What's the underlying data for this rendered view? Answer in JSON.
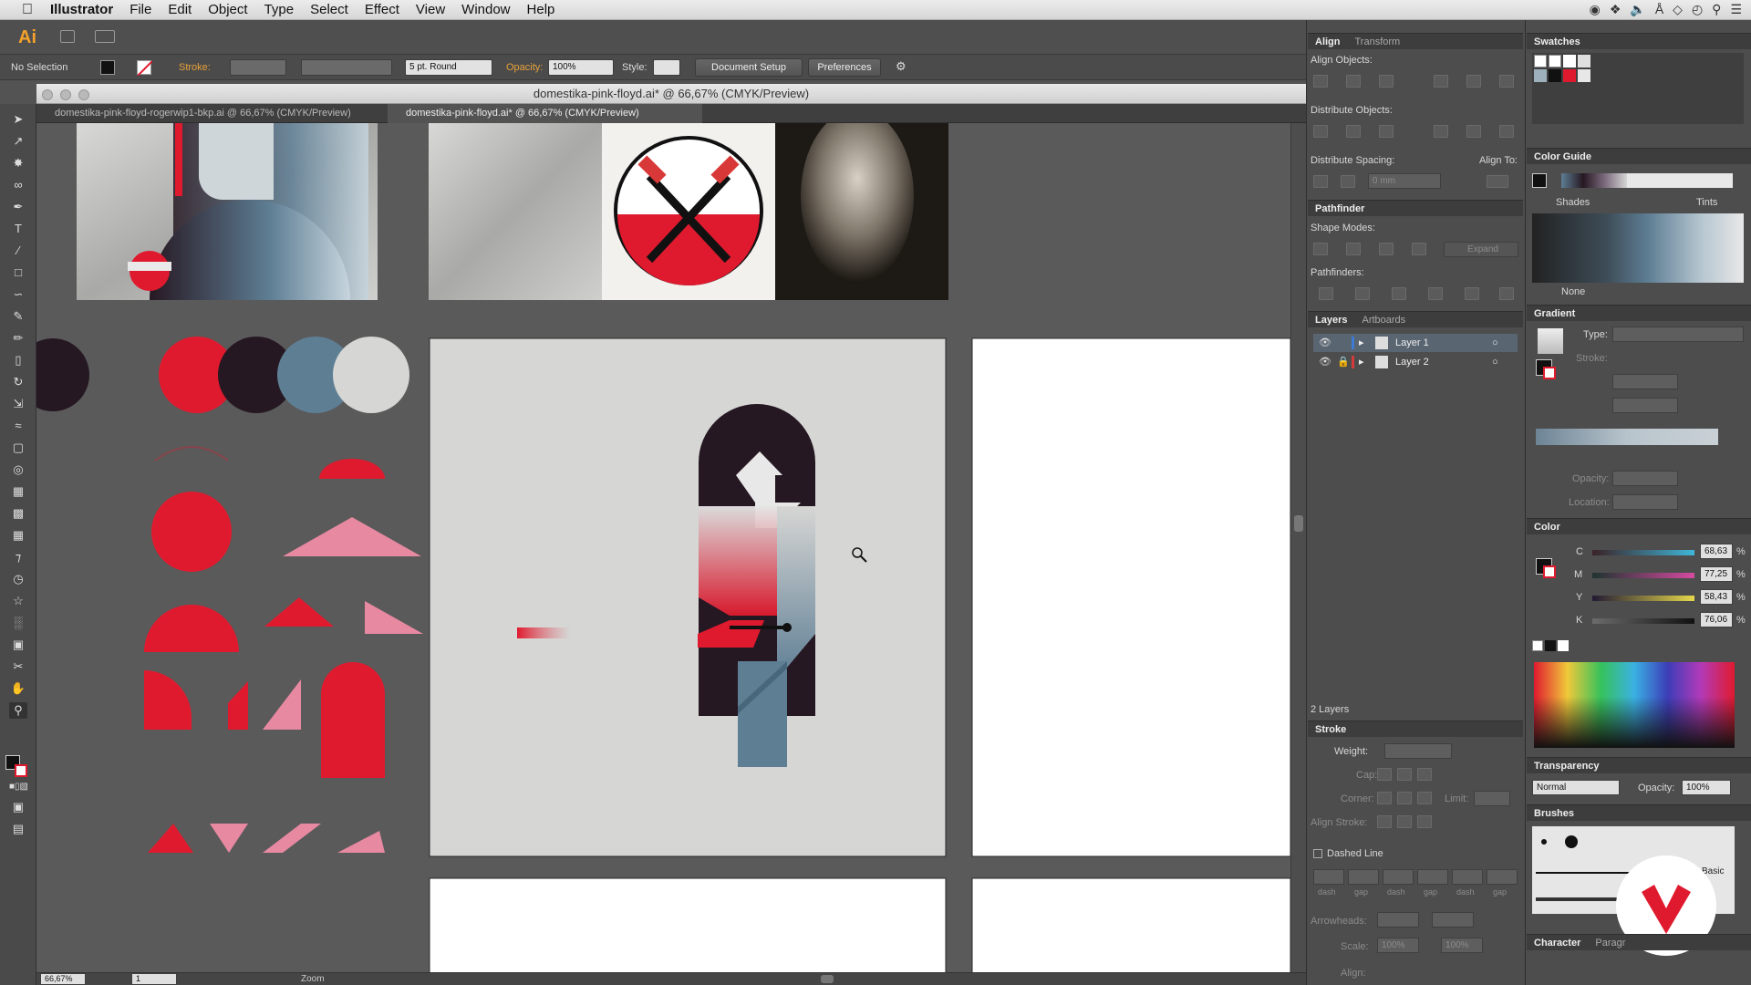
{
  "menubar": {
    "items": [
      "Illustrator",
      "File",
      "Edit",
      "Object",
      "Type",
      "Select",
      "Effect",
      "View",
      "Window",
      "Help"
    ]
  },
  "control": {
    "selection": "No Selection",
    "stroke_label": "Stroke:",
    "brush": "5 pt. Round",
    "opacity_label": "Opacity:",
    "opacity": "100%",
    "style_label": "Style:",
    "document_setup": "Document Setup",
    "preferences": "Preferences"
  },
  "document": {
    "title": "domestika-pink-floyd.ai* @ 66,67% (CMYK/Preview)",
    "tabs": [
      "domestika-pink-floyd-rogerwip1-bkp.ai @ 66,67% (CMYK/Preview)",
      "domestika-pink-floyd.ai* @ 66,67% (CMYK/Preview)"
    ]
  },
  "statusbar": {
    "zoom": "66,67%",
    "artboard": "1",
    "mode": "Zoom"
  },
  "align": {
    "tab_align": "Align",
    "tab_transform": "Transform",
    "align_objects": "Align Objects:",
    "distribute_objects": "Distribute Objects:",
    "distribute_spacing": "Distribute Spacing:",
    "align_to": "Align To:",
    "spacing_value": "0 mm"
  },
  "pathfinder": {
    "title": "Pathfinder",
    "shape_modes": "Shape Modes:",
    "expand": "Expand",
    "pathfinders": "Pathfinders:"
  },
  "layers": {
    "tab_layers": "Layers",
    "tab_artboards": "Artboards",
    "items": [
      {
        "name": "Layer 1",
        "color": "#3d7bd6"
      },
      {
        "name": "Layer 2",
        "color": "#d63b3b"
      }
    ],
    "count": "2 Layers"
  },
  "stroke": {
    "title": "Stroke",
    "weight": "Weight:",
    "cap": "Cap:",
    "corner": "Corner:",
    "limit": "Limit:",
    "align_stroke": "Align Stroke:",
    "dashed_line": "Dashed Line",
    "dash_labels": [
      "dash",
      "gap",
      "dash",
      "gap",
      "dash",
      "gap"
    ],
    "arrowheads": "Arrowheads:",
    "scale": "Scale:",
    "scale_values": [
      "100%",
      "100%"
    ],
    "align": "Align:"
  },
  "swatches": {
    "title": "Swatches"
  },
  "color_guide": {
    "title": "Color Guide",
    "shades": "Shades",
    "tints": "Tints",
    "none": "None"
  },
  "gradient": {
    "title": "Gradient",
    "type": "Type:",
    "stroke": "Stroke:",
    "opacity": "Opacity:",
    "location": "Location:"
  },
  "color": {
    "title": "Color",
    "channels": [
      {
        "label": "C",
        "value": "68,63",
        "color": "#3fb6d8"
      },
      {
        "label": "M",
        "value": "77,25",
        "color": "#d64aa0"
      },
      {
        "label": "Y",
        "value": "58,43",
        "color": "#e6d84a"
      },
      {
        "label": "K",
        "value": "76,06",
        "color": "#111111"
      }
    ],
    "percent": "%"
  },
  "transparency": {
    "title": "Transparency",
    "mode": "Normal",
    "opacity_label": "Opacity:",
    "opacity": "100%"
  },
  "brushes": {
    "title": "Brushes",
    "basic": "Basic"
  },
  "character": {
    "title": "Character",
    "paragraph": "Paragr"
  },
  "colors": {
    "red": "#e01a2e",
    "pink": "#e889a2",
    "dark": "#261822",
    "steel": "#5e7e94",
    "light": "#d6d6d4",
    "accent_orange": "#f3a12a"
  }
}
